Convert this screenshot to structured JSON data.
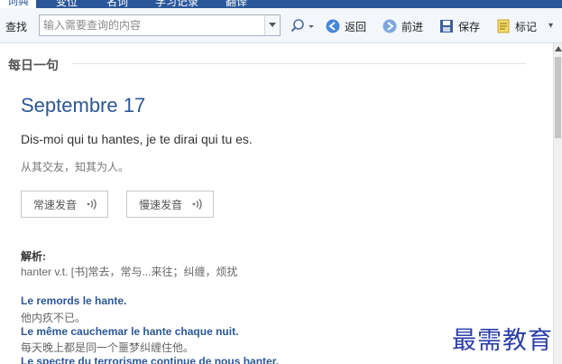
{
  "tabs": [
    {
      "label": "词典",
      "active": true
    },
    {
      "label": "变位",
      "active": false
    },
    {
      "label": "名词",
      "active": false
    },
    {
      "label": "学习记录",
      "active": false
    },
    {
      "label": "翻译",
      "active": false
    }
  ],
  "toolbar": {
    "search_label": "查找",
    "search_placeholder": "输入需要查询的内容",
    "back_label": "返回",
    "forward_label": "前进",
    "save_label": "保存",
    "bookmark_label": "标记",
    "more_glyph": "▾"
  },
  "daily": {
    "section_title": "每日一句",
    "date": "Septembre 17",
    "sentence_fr": "Dis-moi qui tu hantes, je te dirai qui tu es.",
    "sentence_zh": "从其交友，知其为人。",
    "normal_speed_label": "常速发音",
    "slow_speed_label": "慢速发音",
    "analysis_label": "解析:",
    "analysis_text": "hanter v.t. [书]常去，常与...来往；纠缠，烦扰",
    "examples": [
      {
        "fr": "Le remords le hante.",
        "zh": "他内疚不已。"
      },
      {
        "fr": "Le même cauchemar le hante chaque nuit.",
        "zh": "每天晚上都是同一个噩梦纠缠住他。"
      },
      {
        "fr": "Le spectre du terrorisme continue de nous hanter.",
        "zh": ""
      }
    ]
  },
  "watermark": "最需教育",
  "colors": {
    "accent": "#2b579a",
    "link_blue": "#2b5797",
    "watermark": "#2a3ea8"
  }
}
